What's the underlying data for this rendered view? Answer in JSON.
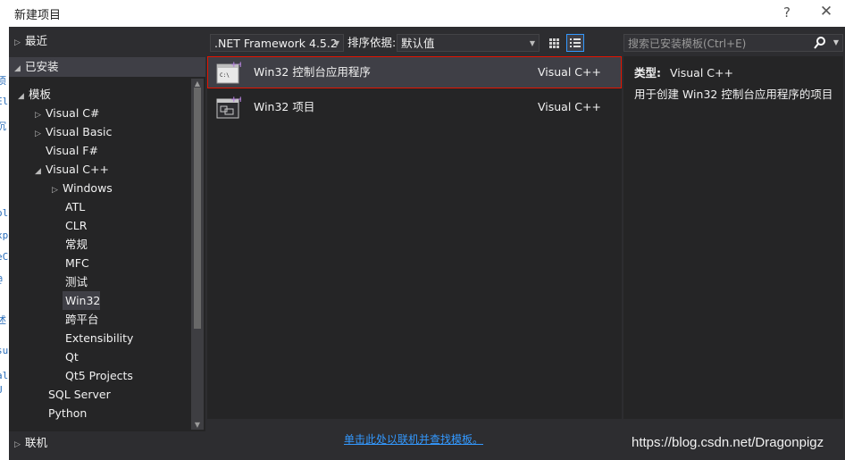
{
  "window": {
    "title": "新建项目",
    "help": "?",
    "close": "✕"
  },
  "background_text": [
    "项",
    "Eli",
    "沉",
    "ol",
    "xp",
    "eC",
    "@",
    "述",
    "su",
    "al",
    "U"
  ],
  "tree": {
    "recent": "最近",
    "installed": "已安装",
    "templates": "模板",
    "items": [
      {
        "label": "Visual C#",
        "arrow": "▷"
      },
      {
        "label": "Visual Basic",
        "arrow": "▷"
      },
      {
        "label": "Visual F#",
        "arrow": ""
      },
      {
        "label": "Visual C++",
        "arrow": "◢"
      },
      {
        "label": "Windows",
        "arrow": "▷"
      },
      {
        "label": "ATL",
        "arrow": ""
      },
      {
        "label": "CLR",
        "arrow": ""
      },
      {
        "label": "常规",
        "arrow": ""
      },
      {
        "label": "MFC",
        "arrow": ""
      },
      {
        "label": "测试",
        "arrow": ""
      },
      {
        "label": "Win32",
        "arrow": ""
      },
      {
        "label": "跨平台",
        "arrow": ""
      },
      {
        "label": "Extensibility",
        "arrow": ""
      },
      {
        "label": "Qt",
        "arrow": ""
      },
      {
        "label": "Qt5 Projects",
        "arrow": ""
      },
      {
        "label": "SQL Server",
        "arrow": ""
      },
      {
        "label": "Python",
        "arrow": ""
      }
    ],
    "online": "联机",
    "selected": "Win32"
  },
  "toolbar": {
    "framework": ".NET Framework 4.5.2",
    "sort_label": "排序依据:",
    "sort_value": "默认值",
    "search_placeholder": "搜索已安装模板(Ctrl+E)"
  },
  "templates": [
    {
      "name": "Win32 控制台应用程序",
      "language": "Visual C++",
      "icon": "console-app-icon",
      "selected": true
    },
    {
      "name": "Win32 项目",
      "language": "Visual C++",
      "icon": "win32-project-icon",
      "selected": false
    }
  ],
  "details": {
    "type_label": "类型:",
    "type_value": "Visual C++",
    "description": "用于创建 Win32 控制台应用程序的项目"
  },
  "online_link": "单击此处以联机并查找模板。",
  "watermark": "https://blog.csdn.net/Dragonpigz",
  "colors": {
    "accent": "#3399ff",
    "selection_border": "#e51400",
    "background": "#2d2d30",
    "panel": "#252526"
  }
}
